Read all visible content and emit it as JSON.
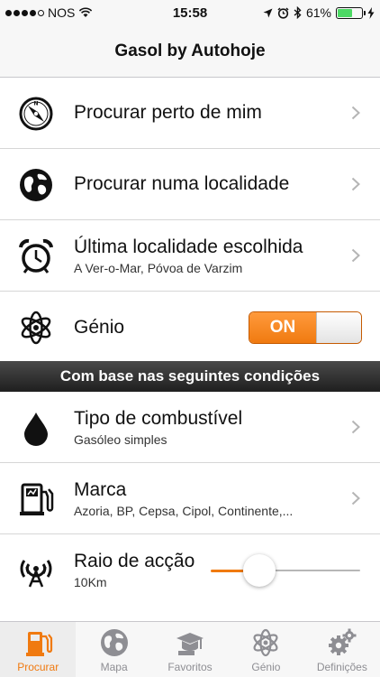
{
  "status_bar": {
    "carrier": "NOS",
    "time": "15:58",
    "battery": "61%",
    "battery_level": 0.61
  },
  "nav": {
    "title": "Gasol by Autohoje"
  },
  "rows": {
    "nearby": {
      "label": "Procurar perto de mim"
    },
    "locality": {
      "label": "Procurar numa localidade"
    },
    "last": {
      "label": "Última localidade escolhida",
      "sub": "A Ver-o-Mar, Póvoa de Varzim"
    },
    "genius": {
      "label": "Génio",
      "toggle_label": "ON",
      "toggle_on": true
    }
  },
  "section_header": "Com base nas seguintes condições",
  "conditions": {
    "fuel": {
      "label": "Tipo de combustível",
      "sub": "Gasóleo simples"
    },
    "brand": {
      "label": "Marca",
      "sub": "Azoria, BP, Cepsa, Cipol, Continente,..."
    },
    "radius": {
      "label": "Raio de acção",
      "sub": "10Km",
      "slider_fraction": 0.28
    }
  },
  "tabs": [
    {
      "label": "Procurar",
      "icon": "fuel-pump-icon",
      "active": true
    },
    {
      "label": "Mapa",
      "icon": "globe-icon",
      "active": false
    },
    {
      "label": "Favoritos",
      "icon": "graduation-cap-icon",
      "active": false
    },
    {
      "label": "Génio",
      "icon": "atom-icon",
      "active": false
    },
    {
      "label": "Definições",
      "icon": "gears-icon",
      "active": false
    }
  ],
  "colors": {
    "accent": "#f07a10",
    "tab_inactive": "#8e8e93",
    "battery": "#4cd964"
  }
}
